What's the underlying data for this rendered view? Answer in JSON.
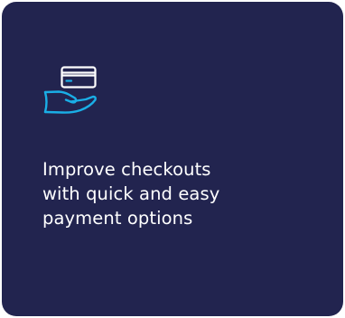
{
  "card": {
    "background_color": "#22244f",
    "icon": "card-in-hand-icon",
    "icon_color": "#1aaee6",
    "headline": "Improve checkouts\nwith quick and easy\npayment options"
  }
}
